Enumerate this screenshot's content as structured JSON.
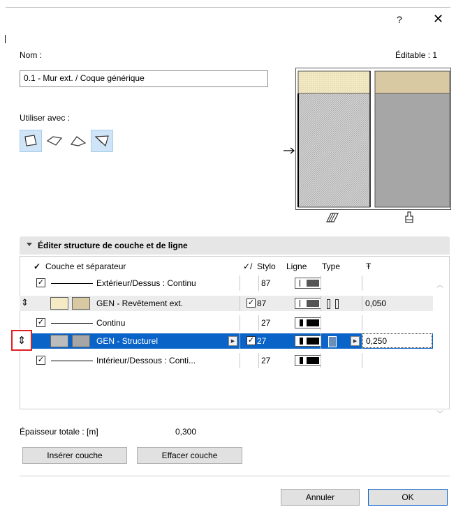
{
  "dialog": {
    "help_glyph": "?",
    "close_glyph": "✕"
  },
  "name_label": "Nom :",
  "editable_label": "Éditable : 1",
  "name_value": "0.1 - Mur ext. / Coque générique",
  "use_with_label": "Utiliser avec :",
  "section_title": "Éditer structure de couche et de ligne",
  "table": {
    "headers": {
      "check": "✓",
      "layer": "Couche et séparateur",
      "pen_glyph": "✓/",
      "stylo": "Stylo",
      "ligne": "Ligne",
      "type": "Type",
      "thick_glyph": "Ŧ"
    },
    "rows": [
      {
        "kind": "sep",
        "checked": true,
        "label": "Extérieur/Dessus : Continu",
        "pen": "87"
      },
      {
        "kind": "layer",
        "handle": "⇕",
        "label": "GEN - Revêtement ext.",
        "checked": true,
        "pen": "87",
        "thickness": "0,050",
        "fill": "#f4ebc5",
        "color": "#d9c9a3"
      },
      {
        "kind": "sep",
        "checked": true,
        "label": "Continu",
        "pen": "27"
      },
      {
        "kind": "layer",
        "handle": "⇕",
        "label": "GEN - Structurel",
        "checked": true,
        "pen": "27",
        "thickness": "0,250",
        "fill": "#bcbcbc",
        "color": "#a6a6a6",
        "selected": true
      },
      {
        "kind": "sep",
        "checked": true,
        "label": "Intérieur/Dessous : Conti...",
        "pen": "27"
      }
    ]
  },
  "total_thickness_label": "Épaisseur totale : [m]",
  "total_thickness_value": "0,300",
  "insert_button": "Insérer couche",
  "delete_button": "Effacer couche",
  "cancel_button": "Annuler",
  "ok_button": "OK",
  "colors": {
    "accent": "#0a64c8",
    "cover": "#f4ebc5",
    "cover_dark": "#d9c9a3",
    "structure": "#a6a6a6"
  }
}
